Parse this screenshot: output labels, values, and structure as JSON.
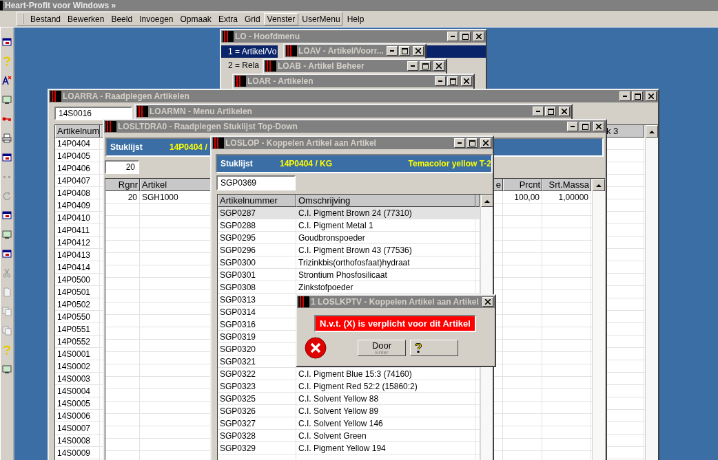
{
  "app": {
    "title": "Heart-Profit voor Windows »"
  },
  "menu": [
    {
      "label": "Bestand",
      "selected": false
    },
    {
      "label": "Bewerken",
      "selected": false
    },
    {
      "label": "Beeld",
      "selected": false
    },
    {
      "label": "Invoegen",
      "selected": false
    },
    {
      "label": "Opmaak",
      "selected": false
    },
    {
      "label": "Extra",
      "selected": false
    },
    {
      "label": "Grid",
      "selected": false
    },
    {
      "label": "Venster",
      "selected": true
    },
    {
      "label": "UserMenu",
      "selected": false
    },
    {
      "label": "Help",
      "selected": false
    }
  ],
  "main_menu_window": {
    "title": "LO - Hoofdmenu",
    "items": [
      {
        "label": "1 = Artikel/Vo",
        "selected": true
      },
      {
        "label": "2 = Rela",
        "selected": false
      }
    ]
  },
  "stock_window": {
    "title": "LOAV - Artikel/Voorr..."
  },
  "article_manage_window": {
    "title": "LOAB - Artikel Beheer"
  },
  "articles_window": {
    "title": "LOAR - Artikelen"
  },
  "lookup_window": {
    "title": "LOARRA - Raadplegen Artikelen",
    "search_value": "14S0016",
    "columns": [
      "Artikelnum",
      "k 3"
    ],
    "rows": [
      "14P0404",
      "14P0405",
      "14P0406",
      "14P0407",
      "14P0408",
      "14P0409",
      "14P0410",
      "14P0411",
      "14P0412",
      "14P0413",
      "14P0414",
      "14P0500",
      "14P0501",
      "14P0502",
      "14P0550",
      "14P0551",
      "14P0552",
      "14S0001",
      "14S0002",
      "14S0003",
      "14S0004",
      "14S0005",
      "14S0006",
      "14S0007",
      "14S0008",
      "14S0009"
    ]
  },
  "menu_articles_window": {
    "title": "LOARMN - Menu Artikelen"
  },
  "bom_window": {
    "title": "LOSLTDRA0 - Raadplegen Stuklijst Top-Down",
    "header_label": "Stuklijst",
    "header_code": "14P0404 /",
    "field_value": "20",
    "columns": [
      "Rgnr",
      "Artikel",
      "e",
      "Prcnt",
      "Srt.Massa"
    ],
    "rows": [
      {
        "rgnr": "20",
        "artikel": "SGH1000",
        "prcnt": "100,00",
        "srt_massa": "1,00000"
      }
    ]
  },
  "link_window": {
    "title": "LOSLOP - Koppelen Artikel aan Artikel",
    "header_label": "Stuklijst",
    "header_code": "14P0404 / KG",
    "header_description": "Temacolor yellow T-2",
    "search_value": "SGP0369",
    "columns": [
      "Artikelnummer",
      "Omschrijving"
    ],
    "rows": [
      {
        "artikelnummer": "SGP0287",
        "omschrijving": "C.I. Pigment Brown 24 (77310)",
        "selected": true
      },
      {
        "artikelnummer": "SGP0288",
        "omschrijving": "C.I. Pigment Metal 1",
        "selected": false
      },
      {
        "artikelnummer": "SGP0295",
        "omschrijving": "Goudbronspoeder",
        "selected": false
      },
      {
        "artikelnummer": "SGP0296",
        "omschrijving": "C.I. Pigment Brown 43 (77536)",
        "selected": false
      },
      {
        "artikelnummer": "SGP0300",
        "omschrijving": "Trizinkbis(orthofosfaat)hydraat",
        "selected": false
      },
      {
        "artikelnummer": "SGP0301",
        "omschrijving": "Strontium Phosfosilicaat",
        "selected": false
      },
      {
        "artikelnummer": "SGP0308",
        "omschrijving": "Zinkstofpoeder",
        "selected": false
      },
      {
        "artikelnummer": "SGP0313",
        "selected": false
      },
      {
        "artikelnummer": "SGP0314",
        "selected": false
      },
      {
        "artikelnummer": "SGP0316",
        "selected": false
      },
      {
        "artikelnummer": "SGP0319",
        "selected": false
      },
      {
        "artikelnummer": "SGP0320",
        "selected": false
      },
      {
        "artikelnummer": "SGP0321",
        "selected": false
      },
      {
        "artikelnummer": "SGP0322",
        "omschrijving": "C.I. Pigment Blue 15:3 (74160)",
        "selected": false
      },
      {
        "artikelnummer": "SGP0323",
        "omschrijving": "C.I. Pigment Red 52:2 (15860:2)",
        "selected": false
      },
      {
        "artikelnummer": "SGP0325",
        "omschrijving": "C.I. Solvent Yellow 88",
        "selected": false
      },
      {
        "artikelnummer": "SGP0326",
        "omschrijving": "C.I. Solvent Yellow 89",
        "selected": false
      },
      {
        "artikelnummer": "SGP0327",
        "omschrijving": "C.I. Solvent Yellow 146",
        "selected": false
      },
      {
        "artikelnummer": "SGP0328",
        "omschrijving": "C.I. Solvent Green",
        "selected": false
      },
      {
        "artikelnummer": "SGP0329",
        "omschrijving": "C.I. Pigment Yellow 194",
        "selected": false
      }
    ]
  },
  "error_dialog": {
    "title": "1 LOSLKPTV - Koppelen Artikel aan Artikel",
    "message": "N.v.t. (X) is verplicht voor dit Artikel",
    "buttons": [
      {
        "kind": "text",
        "label": "Door",
        "hint": "Enter"
      },
      {
        "kind": "help"
      }
    ]
  }
}
